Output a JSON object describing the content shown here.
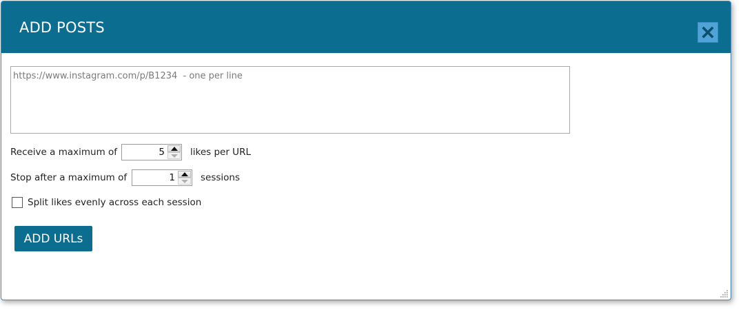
{
  "dialog": {
    "title": "ADD POSTS",
    "close_icon": "close-x-icon",
    "colors": {
      "header": "#0b6e91",
      "close_button": "#4fa3d6",
      "primary_button": "#0b6e91"
    }
  },
  "urls": {
    "placeholder": "https://www.instagram.com/p/B1234  - one per line",
    "value": ""
  },
  "likes_row": {
    "prefix": "Receive a maximum of",
    "value": "5",
    "suffix": "likes per URL"
  },
  "sessions_row": {
    "prefix": "Stop after a maximum of",
    "value": "1",
    "suffix": "sessions"
  },
  "split": {
    "label": "Split likes evenly across each session",
    "checked": false
  },
  "actions": {
    "add_label": "ADD URLs"
  }
}
